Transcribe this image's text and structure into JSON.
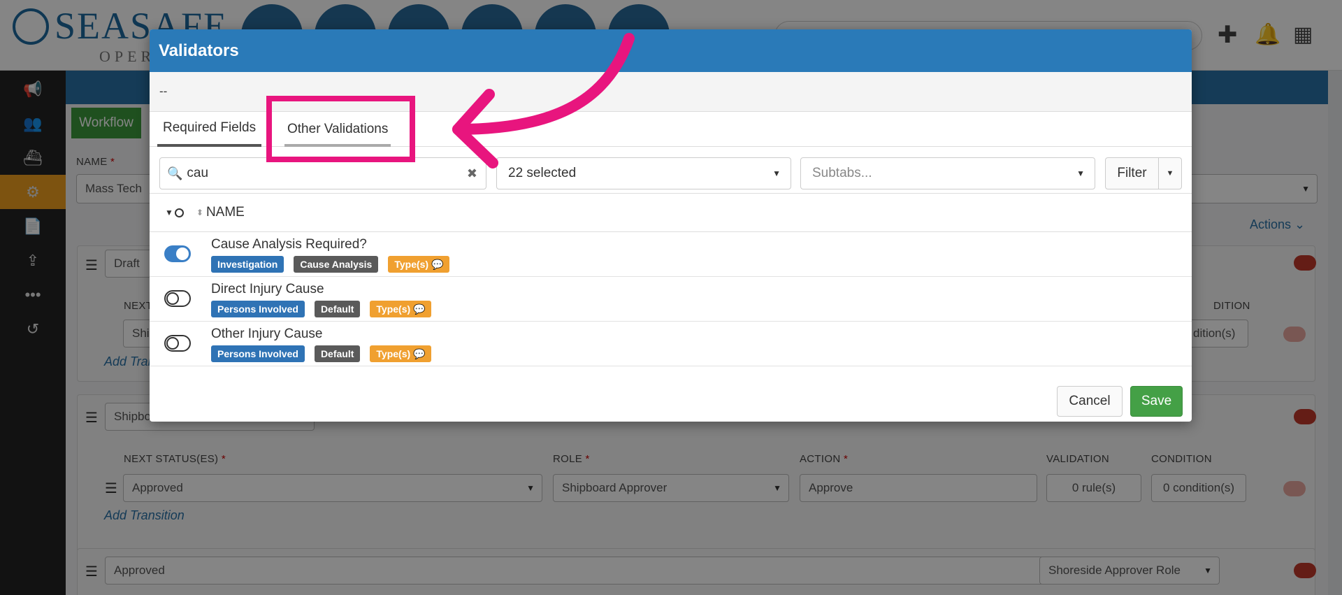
{
  "app": {
    "logo_main": "SEASAFE",
    "logo_sub": "OPER",
    "workflow_tab": "Workflow",
    "name_label": "NAME",
    "name_value": "Mass Tech",
    "actions_label": "Actions",
    "statuses": [
      {
        "status": "Draft",
        "transition": "Shi"
      },
      {
        "status": "Shipboard",
        "next_status": "Approved",
        "role": "Shipboard Approver",
        "action": "Approve",
        "validation": "0 rule(s)",
        "condition": "0 condition(s)"
      },
      {
        "status": "Approved",
        "role": "Shoreside Approver Role"
      }
    ],
    "labels": {
      "next_statuses": "NEXT STATUS(ES)",
      "next_short": "NEXT",
      "role": "ROLE",
      "action": "ACTION",
      "validation": "VALIDATION",
      "condition": "CONDITION",
      "condition_short": "DITION",
      "condition_value_partial": "dition(s)",
      "add_transition": "Add Transition",
      "add_transition_partial": "Add Tran"
    }
  },
  "modal": {
    "title": "Validators",
    "subtitle": "--",
    "tabs": [
      {
        "label": "Required Fields",
        "active": true
      },
      {
        "label": "Other Validations",
        "active": false
      }
    ],
    "search": {
      "value": "cau"
    },
    "selected_dropdown": "22 selected",
    "subtabs_placeholder": "Subtabs...",
    "filter_label": "Filter",
    "column_name": "NAME",
    "rows": [
      {
        "name": "Cause Analysis Required?",
        "enabled": true,
        "badges": [
          {
            "text": "Investigation",
            "color": "blue"
          },
          {
            "text": "Cause Analysis",
            "color": "gray"
          },
          {
            "text": "Type(s)",
            "color": "orange"
          }
        ]
      },
      {
        "name": "Direct Injury Cause",
        "enabled": false,
        "badges": [
          {
            "text": "Persons Involved",
            "color": "blue"
          },
          {
            "text": "Default",
            "color": "gray"
          },
          {
            "text": "Type(s)",
            "color": "orange"
          }
        ]
      },
      {
        "name": "Other Injury Cause",
        "enabled": false,
        "badges": [
          {
            "text": "Persons Involved",
            "color": "blue"
          },
          {
            "text": "Default",
            "color": "gray"
          },
          {
            "text": "Type(s)",
            "color": "orange"
          }
        ]
      }
    ],
    "cancel_label": "Cancel",
    "save_label": "Save"
  },
  "colors": {
    "header_blue": "#2a7ab8",
    "save_green": "#44a046",
    "highlight_pink": "#e8157e",
    "badge_blue": "#2f73b5",
    "badge_gray": "#5a5a5a",
    "badge_orange": "#f0a030"
  }
}
